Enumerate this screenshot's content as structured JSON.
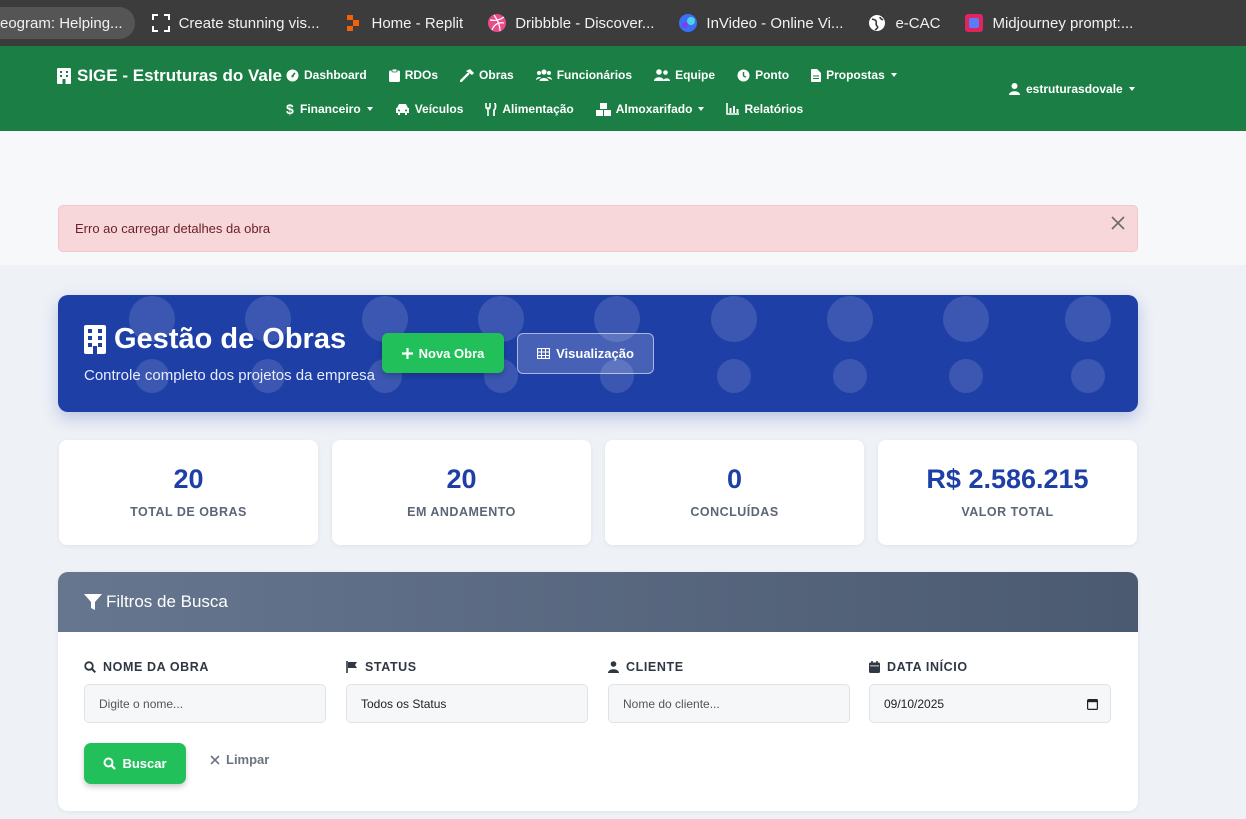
{
  "bookmarks": [
    {
      "label": "eogram: Helping...",
      "icon": "telegram-icon"
    },
    {
      "label": "Create stunning vis...",
      "icon": "frame-icon"
    },
    {
      "label": "Home - Replit",
      "icon": "replit-icon"
    },
    {
      "label": "Dribbble - Discover...",
      "icon": "dribbble-icon"
    },
    {
      "label": "InVideo - Online Vi...",
      "icon": "invideo-icon"
    },
    {
      "label": "e-CAC",
      "icon": "globe-icon"
    },
    {
      "label": "Midjourney prompt:...",
      "icon": "midjourney-icon"
    }
  ],
  "navbar": {
    "brand": "SIGE - Estruturas do Vale",
    "row1": [
      {
        "label": "Dashboard",
        "icon": "gauge-icon"
      },
      {
        "label": "RDOs",
        "icon": "clipboard-icon"
      },
      {
        "label": "Obras",
        "icon": "hammer-icon"
      },
      {
        "label": "Funcionários",
        "icon": "users-icon"
      },
      {
        "label": "Equipe",
        "icon": "team-icon"
      },
      {
        "label": "Ponto",
        "icon": "clock-icon"
      },
      {
        "label": "Propostas",
        "icon": "file-icon",
        "dropdown": true
      }
    ],
    "row2": [
      {
        "label": "Financeiro",
        "icon": "dollar-icon",
        "dropdown": true
      },
      {
        "label": "Veículos",
        "icon": "car-icon"
      },
      {
        "label": "Alimentação",
        "icon": "utensils-icon"
      },
      {
        "label": "Almoxarifado",
        "icon": "boxes-icon",
        "dropdown": true
      },
      {
        "label": "Relatórios",
        "icon": "chart-icon"
      }
    ],
    "user": "estruturasdovale"
  },
  "alert": {
    "message": "Erro ao carregar detalhes da obra"
  },
  "hero": {
    "title": "Gestão de Obras",
    "subtitle": "Controle completo dos projetos da empresa",
    "new_button": "Nova Obra",
    "view_button": "Visualização"
  },
  "stats": [
    {
      "value": "20",
      "label": "TOTAL DE OBRAS"
    },
    {
      "value": "20",
      "label": "EM ANDAMENTO"
    },
    {
      "value": "0",
      "label": "CONCLUÍDAS"
    },
    {
      "value": "R$ 2.586.215",
      "label": "VALOR TOTAL"
    }
  ],
  "filters": {
    "title": "Filtros de Busca",
    "name_label": "NOME DA OBRA",
    "name_placeholder": "Digite o nome...",
    "status_label": "STATUS",
    "status_value": "Todos os Status",
    "client_label": "CLIENTE",
    "client_placeholder": "Nome do cliente...",
    "date_label": "DATA INÍCIO",
    "date_value": "09/10/2025",
    "search_button": "Buscar",
    "clear_button": "Limpar"
  },
  "colors": {
    "navbar": "#1b7e44",
    "hero": "#1e3fa6",
    "accent_green": "#22c05a",
    "alert_bg": "#f7d7da"
  }
}
